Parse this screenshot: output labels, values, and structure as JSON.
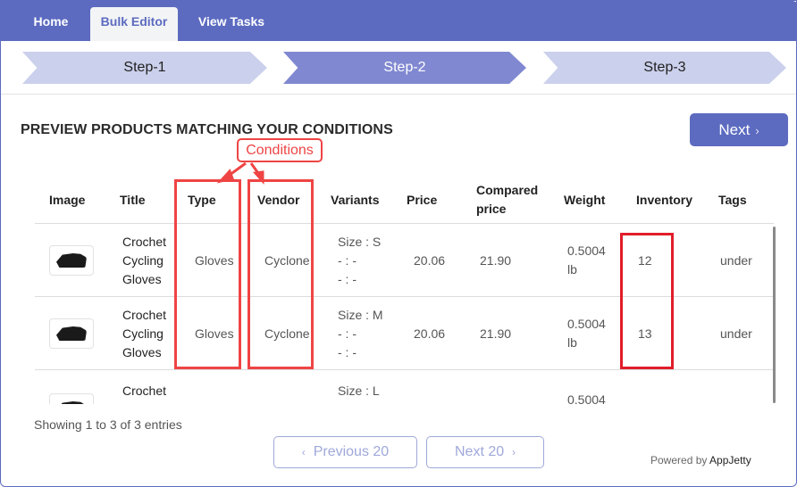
{
  "nav": {
    "tabs": [
      {
        "label": "Home",
        "active": false
      },
      {
        "label": "Bulk Editor",
        "active": true
      },
      {
        "label": "View Tasks",
        "active": false
      }
    ]
  },
  "steps": [
    {
      "label": "Step-1",
      "state": "done"
    },
    {
      "label": "Step-2",
      "state": "current"
    },
    {
      "label": "Step-3",
      "state": "upcoming"
    }
  ],
  "heading": "PREVIEW PRODUCTS MATCHING YOUR CONDITIONS",
  "next_button": {
    "label": "Next",
    "icon": "chevron-right-icon"
  },
  "annotation": {
    "label": "Conditions",
    "color": "#ef4444",
    "highlighted_columns": [
      "Type",
      "Vendor",
      "Inventory"
    ]
  },
  "table": {
    "columns": [
      "Image",
      "Title",
      "Type",
      "Vendor",
      "Variants",
      "Price",
      "Compared price",
      "Weight",
      "Inventory",
      "Tags"
    ],
    "rows": [
      {
        "image": "gloves-thumbnail",
        "title": "Crochet Cycling Gloves",
        "type": "Gloves",
        "vendor": "Cyclone",
        "variants": [
          "Size : S",
          "- : -",
          "- : -"
        ],
        "price": "20.06",
        "compared_price": "21.90",
        "weight": "0.5004 lb",
        "inventory": "12",
        "tags": "under"
      },
      {
        "image": "gloves-thumbnail",
        "title": "Crochet Cycling Gloves",
        "type": "Gloves",
        "vendor": "Cyclone",
        "variants": [
          "Size : M",
          "- : -",
          "- : -"
        ],
        "price": "20.06",
        "compared_price": "21.90",
        "weight": "0.5004 lb",
        "inventory": "13",
        "tags": "under"
      },
      {
        "image": "gloves-thumbnail",
        "title": "Crochet",
        "type": "",
        "vendor": "",
        "variants": [
          "Size : L"
        ],
        "price": "",
        "compared_price": "",
        "weight": "0.5004",
        "inventory": "",
        "tags": ""
      }
    ]
  },
  "footer": {
    "entries": "Showing 1 to 3 of 3 entries",
    "prev_label": "Previous 20",
    "next_label": "Next 20",
    "powered_prefix": "Powered by",
    "powered_brand": "AppJetty"
  },
  "colors": {
    "brand": "#5c6bc0",
    "step_active": "#8088d1",
    "step_inactive": "#cbd0ec",
    "annotation": "#ef4444"
  }
}
